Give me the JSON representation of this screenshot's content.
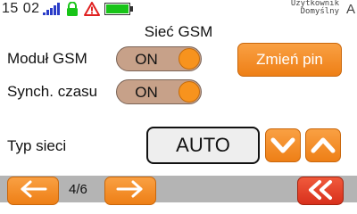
{
  "status": {
    "time": "15 02",
    "user_line1": "Użytkownik",
    "user_line2": "Domyślny",
    "user_letter": "A"
  },
  "screen": {
    "title": "Sieć GSM",
    "gsm_module_label": "Moduł GSM",
    "gsm_module_value": "ON",
    "sync_time_label": "Synch. czasu",
    "sync_time_value": "ON",
    "change_pin_label": "Zmień pin",
    "network_type_label": "Typ sieci",
    "network_type_value": "AUTO"
  },
  "nav": {
    "page": "4/6"
  },
  "colors": {
    "accent": "#f7931e",
    "toggle_bg": "#c7a189",
    "bottom_bar": "#b4b4b4",
    "signal": "#2a3cc8",
    "ok_green": "#18c418",
    "warn_red": "#e02020"
  },
  "icons": [
    "signal-icon",
    "lock-icon",
    "warning-icon",
    "battery-icon",
    "chevron-down-icon",
    "chevron-up-icon",
    "arrow-left-icon",
    "arrow-right-icon",
    "double-chevron-left-icon"
  ]
}
